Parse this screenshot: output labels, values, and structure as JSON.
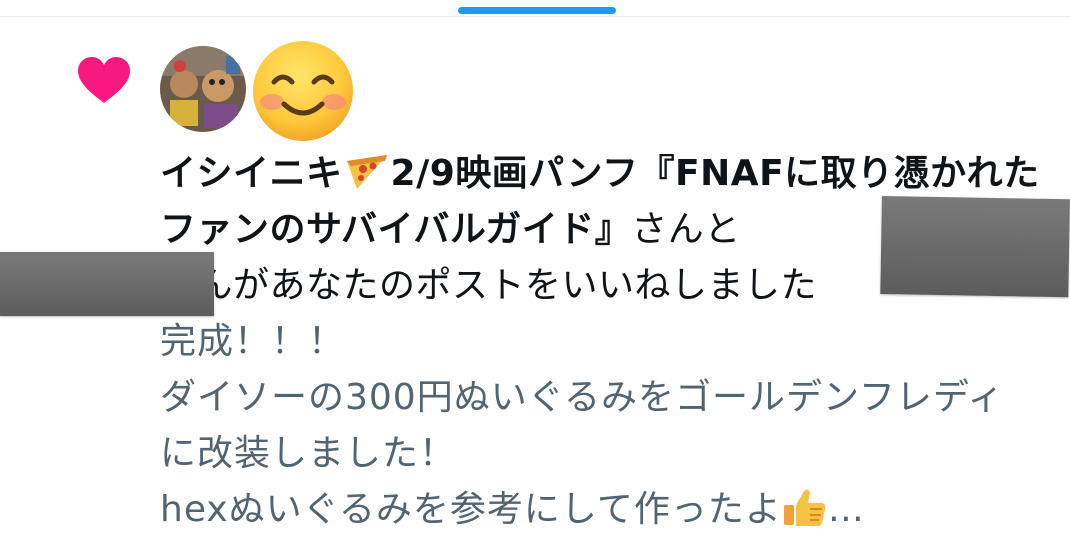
{
  "pull_indicator_color": "#1d9bf0",
  "notification": {
    "heart_color": "#f91880",
    "avatars": {
      "user_avatar": "photo-avatar",
      "second_avatar": "smiling-face-emoji"
    },
    "headline": {
      "name_1": "イシイニキ",
      "name_1_icon": "pizza-emoji",
      "name_1_rest": "2/9映画パンフ『FNAFに取り憑かれたファンのサバイバルガイド』",
      "connector": "さんと",
      "tail": "さんがあなたのポストをいいねしました"
    },
    "post_preview": {
      "line_1": "完成！！！",
      "line_2": "ダイソーの300円ぬいぐるみをゴールデンフレディに改装しました！",
      "line_3": "hexぬいぐるみを参考にして作ったよ",
      "line_3_icon": "thumbs-up-emoji",
      "ellipsis": "…"
    }
  }
}
